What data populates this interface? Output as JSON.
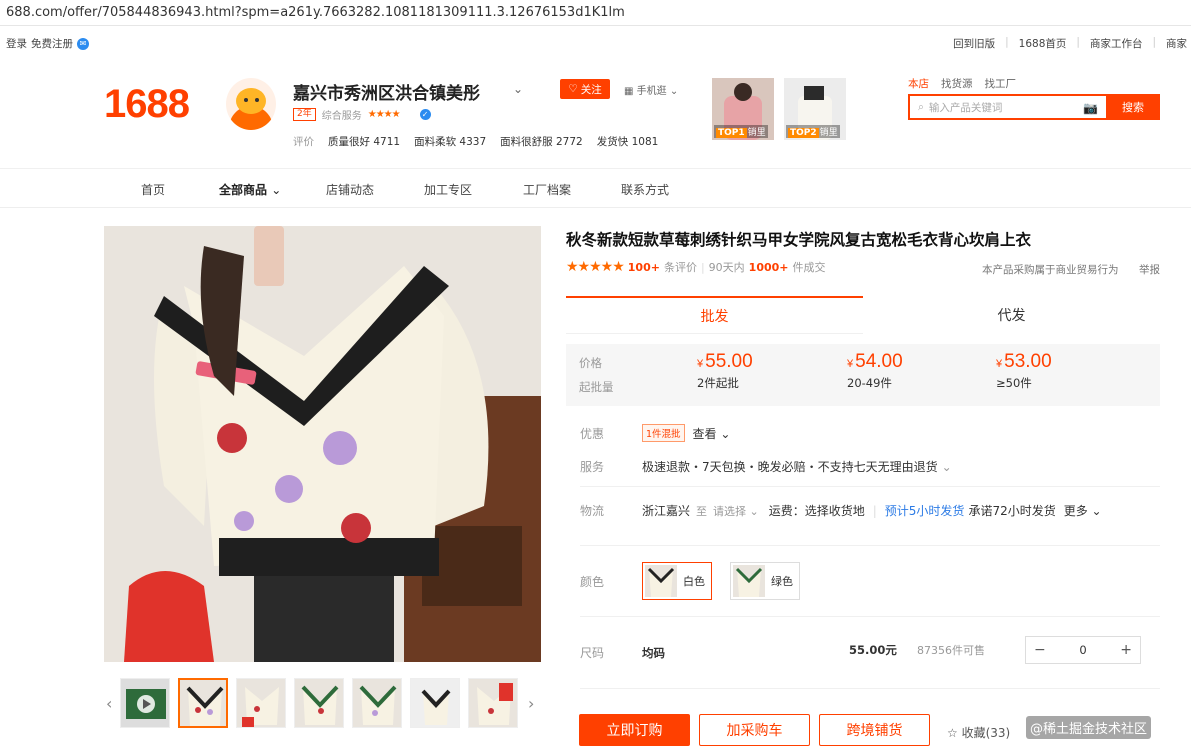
{
  "browser": {
    "url": "688.com/offer/705844836943.html?spm=a261y.7663282.1081181309111.3.12676153d1K1lm"
  },
  "topbar": {
    "login": "登录",
    "register": "免费注册",
    "links": [
      "回到旧版",
      "1688首页",
      "商家工作台",
      "商家"
    ]
  },
  "header": {
    "logo": "1688",
    "shop_name": "嘉兴市秀洲区洪合镇美彤",
    "year_badge": "2年",
    "service_label": "综合服务",
    "service_stars": "★★★★",
    "follow_label": "关注",
    "mobile_label": "手机逛",
    "eval_label": "评价",
    "evals": [
      {
        "label": "质量很好",
        "count": "4711"
      },
      {
        "label": "面料柔软",
        "count": "4337"
      },
      {
        "label": "面料很舒服",
        "count": "2772"
      },
      {
        "label": "发货快",
        "count": "1081"
      }
    ],
    "top_thumbs": [
      {
        "rank": "TOP1",
        "text": "销里"
      },
      {
        "rank": "TOP2",
        "text": "销里"
      }
    ],
    "search_tabs": [
      "本店",
      "找货源",
      "找工厂"
    ],
    "search_placeholder": "输入产品关键词",
    "search_button": "搜索"
  },
  "nav": {
    "items": [
      "首页",
      "全部商品",
      "店铺动态",
      "加工专区",
      "工厂档案",
      "联系方式"
    ]
  },
  "product": {
    "title": "秋冬新款短款草莓刺绣针织马甲女学院风复古宽松毛衣背心坎肩上衣",
    "stars": "★★★★★",
    "review_count": "100+",
    "review_label": "条评价",
    "days_label": "90天内",
    "sold_count": "1000+",
    "sold_label": "件成交",
    "biz_note": "本产品采购属于商业贸易行为",
    "report": "举报",
    "tabs": [
      "批发",
      "代发"
    ],
    "price_label": "价格",
    "moq_label": "起批量",
    "currency": "¥",
    "tiers": [
      {
        "price": "55.00",
        "qty": "2件起批"
      },
      {
        "price": "54.00",
        "qty": "20-49件"
      },
      {
        "price": "53.00",
        "qty": "≥50件"
      }
    ],
    "promo_label": "优惠",
    "promo_tag": "1件混批",
    "promo_view": "查看",
    "service_label": "服务",
    "service_text": "极速退款・7天包换・晚发必赔・不支持七天无理由退货",
    "logistics_label": "物流",
    "origin": "浙江嘉兴",
    "to": "至",
    "choose": "请选择",
    "shipping": "运费：选择收货地",
    "eta": "预计5小时发货",
    "promise": "承诺72小时发货",
    "more": "更多",
    "color_label": "颜色",
    "colors": [
      "白色",
      "绿色"
    ],
    "size_label": "尺码",
    "size": "均码",
    "size_price": "55.00元",
    "stock": "87356件可售",
    "qty": "0",
    "buy_now": "立即订购",
    "add_cart": "加采购车",
    "cross_border": "跨境铺货",
    "favorite": "收藏(33)"
  },
  "watermark": "@稀土掘金技术社区"
}
